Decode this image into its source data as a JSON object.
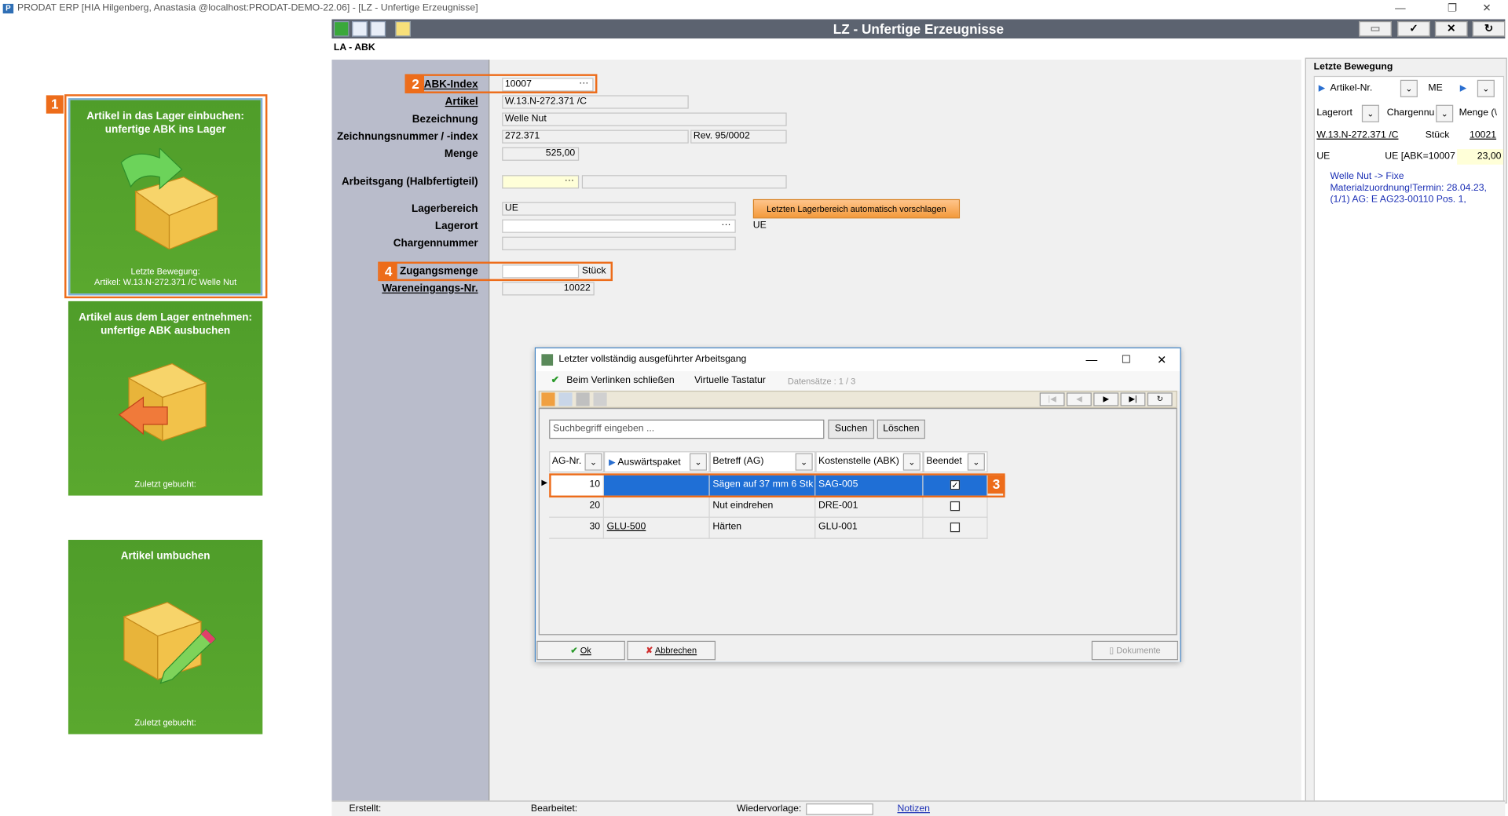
{
  "window": {
    "title": "PRODAT ERP   [HIA Hilgenberg, Anastasia @localhost:PRODAT-DEMO-22.06] - [LZ - Unfertige Erzeugnisse]",
    "logo_text": "P"
  },
  "tiles": [
    {
      "badge": "1",
      "title1": "Artikel in das Lager einbuchen:",
      "title2": "unfertige ABK ins Lager",
      "foot1": "Letzte Bewegung:",
      "foot2": "Artikel: W.13.N-272.371 /C Welle Nut"
    },
    {
      "title1": "Artikel aus dem Lager entnehmen:",
      "title2": "unfertige ABK ausbuchen",
      "foot1": "Zuletzt gebucht:"
    },
    {
      "title1": "Artikel umbuchen",
      "foot1": "Zuletzt gebucht:"
    }
  ],
  "header": {
    "title": "LZ - Unfertige Erzeugnisse",
    "breadcrumb": "LA - ABK"
  },
  "form": {
    "abk_label": "ABK-Index",
    "abk_value": "10007",
    "badge2": "2",
    "artikel_label": "Artikel",
    "artikel_value": "W.13.N-272.371 /C",
    "bez_label": "Bezeichnung",
    "bez_value": "Welle Nut",
    "zeich_label": "Zeichnungsnummer / -index",
    "zeich_value": "272.371",
    "zeich_rev": "Rev. 95/0002",
    "menge_label": "Menge",
    "menge_value": "525,00",
    "ag_label": "Arbeitsgang (Halbfertigteil)",
    "lb_label": "Lagerbereich",
    "lb_value": "UE",
    "orange_btn": "Letzten Lagerbereich automatisch vorschlagen",
    "lo_label": "Lagerort",
    "lo_side": "UE",
    "ch_label": "Chargennummer",
    "zug_label": "Zugangsmenge",
    "zug_unit": "Stück",
    "badge4": "4",
    "we_label": "Wareneingangs-Nr.",
    "we_value": "10022"
  },
  "right": {
    "title": "Letzte Bewegung",
    "col1": "Artikel-Nr.",
    "col2": "ME",
    "col3": "Lagerort",
    "col4": "Chargennu",
    "col5": "Menge (\\",
    "r1c1": "W.13.N-272.371 /C",
    "r1c2": "Stück",
    "r1c3": "10021",
    "r2c1": "UE",
    "r2c2": "UE [ABK=10007",
    "r2c3": "23,00",
    "note": "Welle Nut -> Fixe Materialzuordnung!Termin: 28.04.23, (1/1) AG: E AG23-00110 Pos. 1,"
  },
  "status": {
    "erstellt": "Erstellt:",
    "bearbeitet": "Bearbeitet:",
    "wiedervorlage": "Wiedervorlage:",
    "notizen": "Notizen"
  },
  "dialog": {
    "title": "Letzter vollständig ausgeführter Arbeitsgang",
    "close_btn": "Beim Verlinken schließen",
    "vk": "Virtuelle Tastatur",
    "records": "Datensätze : 1 / 3",
    "search_placeholder": "Suchbegriff eingeben ...",
    "suchen": "Suchen",
    "loeschen": "Löschen",
    "headers": [
      "AG-Nr.",
      "Auswärtspaket",
      "Betreff (AG)",
      "Kostenstelle (ABK)",
      "Beendet"
    ],
    "rows": [
      {
        "ag": "10",
        "paket": "",
        "betreff": "Sägen auf 37 mm 6 Stk",
        "kst": "SAG-005",
        "done": true
      },
      {
        "ag": "20",
        "paket": "",
        "betreff": "Nut eindrehen",
        "kst": "DRE-001",
        "done": false
      },
      {
        "ag": "30",
        "paket": "GLU-500",
        "betreff": "Härten",
        "kst": "GLU-001",
        "done": false
      }
    ],
    "badge3": "3",
    "ok": "Ok",
    "abbrechen": "Abbrechen",
    "dokumente": "Dokumente"
  }
}
